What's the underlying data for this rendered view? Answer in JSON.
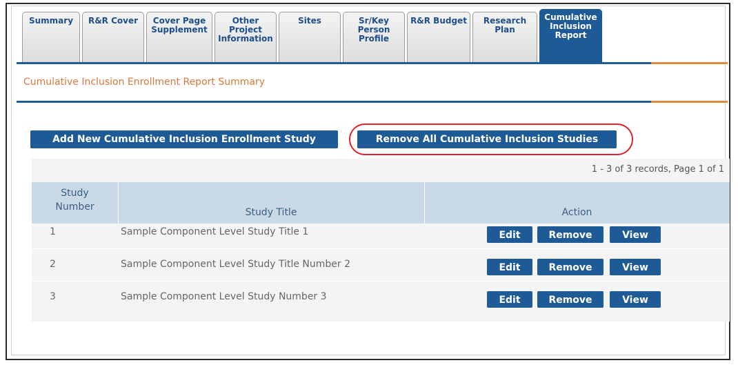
{
  "tabs": [
    {
      "label": "Summary"
    },
    {
      "label": "R&R Cover"
    },
    {
      "label": "Cover Page\nSupplement"
    },
    {
      "label": "Other\nProject\nInformation"
    },
    {
      "label": "Sites"
    },
    {
      "label": "Sr/Key\nPerson\nProfile"
    },
    {
      "label": "R&R Budget"
    },
    {
      "label": "Research\nPlan"
    },
    {
      "label": "Cumulative\nInclusion\nReport",
      "active": true
    }
  ],
  "section_title": "Cumulative Inclusion Enrollment Report Summary",
  "buttons": {
    "add_study": "Add New Cumulative Inclusion Enrollment Study",
    "remove_all": "Remove All Cumulative Inclusion Studies"
  },
  "table": {
    "records_info": "1 - 3 of 3 records, Page 1 of 1",
    "headers": {
      "study_number": "Study\nNumber",
      "study_title": "Study Title",
      "action": "Action"
    },
    "rows": [
      {
        "number": "1",
        "title": "Sample Component Level Study Title 1"
      },
      {
        "number": "2",
        "title": "Sample Component Level Study Title Number 2"
      },
      {
        "number": "3",
        "title": "Sample Component Level Study Number 3"
      }
    ],
    "actions": {
      "edit": "Edit",
      "remove": "Remove",
      "view": "View"
    }
  },
  "colors": {
    "accent_blue": "#1d5a96",
    "accent_orange": "#e08a3c",
    "highlight_red": "#e0242b"
  }
}
